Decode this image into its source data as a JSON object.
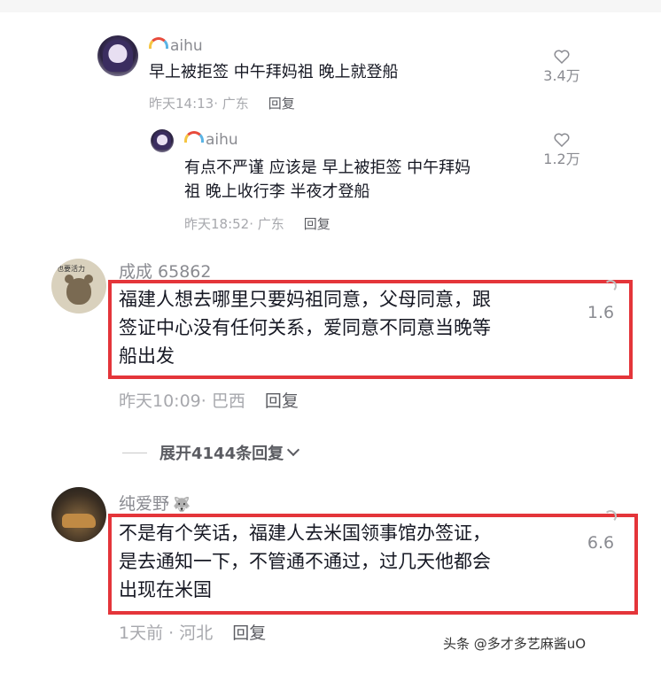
{
  "comments": [
    {
      "username": "aihu",
      "text": "早上被拒签 中午拜妈祖 晚上就登船",
      "time_location": "昨天14:13· 广东",
      "reply_label": "回复",
      "likes": "3.4万"
    },
    {
      "username": "aihu",
      "text_lines": [
        "有点不严谨 应该是 早上被拒签 中午拜妈",
        "祖 晚上收行李 半夜才登船"
      ],
      "time_location": "昨天18:52· 广东",
      "reply_label": "回复",
      "likes": "1.2万"
    },
    {
      "username": "成成 65862",
      "avatar_text": "也要活力",
      "text_lines": [
        "福建人想去哪里只要妈祖同意，父母同意，跟",
        "签证中心没有任何关系，爱同意不同意当晚等",
        "船出发"
      ],
      "time_location": "昨天10:09· 巴西",
      "reply_label": "回复",
      "likes": "1.6"
    },
    {
      "username": "纯爱野",
      "text_lines": [
        "不是有个笑话，福建人去米国领事馆办签证，",
        "是去通知一下，不管通不通过，过几天他都会",
        "出现在米国"
      ],
      "time_location": "1天前 · 河北",
      "reply_label": "回复",
      "likes": "6.6"
    }
  ],
  "expand_replies": "展开4144条回复",
  "watermark": "头条 @多才多艺麻酱uO",
  "colors": {
    "highlight_box": "#e4353a",
    "meta_text": "#a7a8ad",
    "body_text": "#161823"
  },
  "icons": {
    "like": "heart-outline-icon",
    "expand": "chevron-down-icon",
    "badge": "rainbow-icon"
  }
}
